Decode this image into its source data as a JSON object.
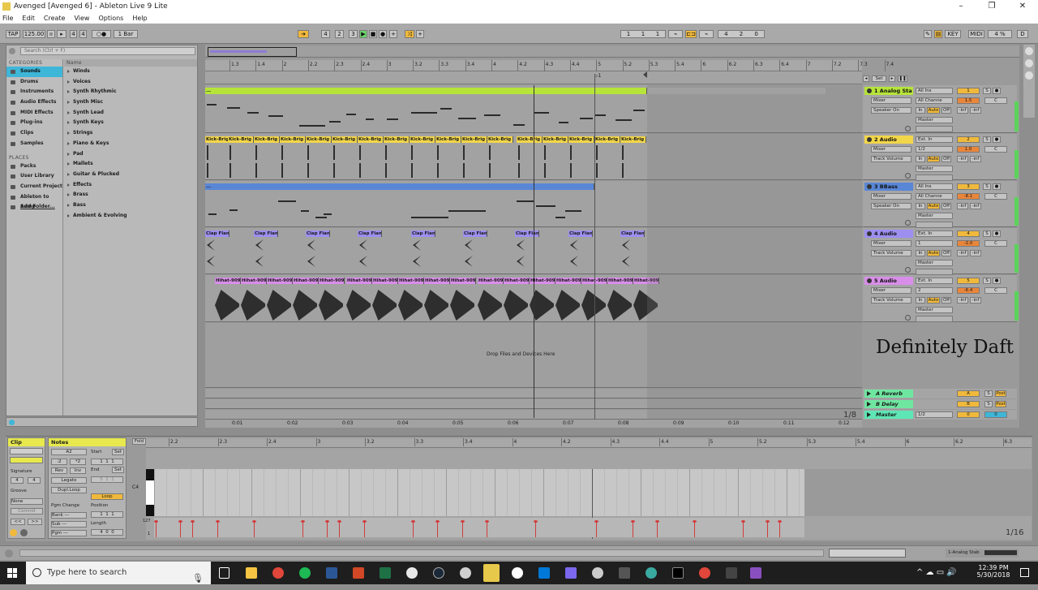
{
  "window": {
    "title": "Avenged  [Avenged 6] - Ableton Live 9 Lite",
    "controls": [
      "–",
      "❐",
      "✕"
    ]
  },
  "menu": [
    "File",
    "Edit",
    "Create",
    "View",
    "Options",
    "Help"
  ],
  "control_bar": {
    "tap": "TAP",
    "tempo": "125.00",
    "sig_num": "4",
    "sig_den": "4",
    "quant": "1 Bar",
    "pos": [
      "4",
      "2",
      "3"
    ],
    "loop_start": [
      "1",
      "1",
      "1"
    ],
    "loop_len": [
      "4",
      "2",
      "0"
    ],
    "key": "KEY",
    "midi": "MIDI",
    "cpu": "4 %",
    "h": "H",
    "d": "D"
  },
  "browser": {
    "search_placeholder": "Search (Ctrl + F)",
    "categories_header": "CATEGORIES",
    "name_header": "Name",
    "categories": [
      "Sounds",
      "Drums",
      "Instruments",
      "Audio Effects",
      "MIDI Effects",
      "Plug-ins",
      "Clips",
      "Samples"
    ],
    "places_header": "PLACES",
    "places": [
      "Packs",
      "User Library",
      "Current Project",
      "Ableton to Samp",
      "Add Folder..."
    ],
    "names": [
      "Winds",
      "Voices",
      "Synth Rhythmic",
      "Synth Misc",
      "Synth Lead",
      "Synth Keys",
      "Strings",
      "Piano & Keys",
      "Pad",
      "Mallets",
      "Guitar & Plucked",
      "Effects",
      "Brass",
      "Bass",
      "Ambient & Evolving"
    ]
  },
  "ruler": {
    "marks": [
      "1.3",
      "1.4",
      "2",
      "2.2",
      "2.3",
      "2.4",
      "3",
      "3.2",
      "3.3",
      "3.4",
      "4",
      "4.2",
      "4.3",
      "4.4",
      "5",
      "5.2",
      "5.3",
      "5.4",
      "6",
      "6.2",
      "6.3",
      "6.4",
      "7",
      "7.2",
      "7.3",
      "7.4"
    ],
    "time_marks": [
      "0:01",
      "0:02",
      "0:03",
      "0:04",
      "0:05",
      "0:06",
      "0:07",
      "0:08",
      "0:09",
      "0:10",
      "0:11",
      "0:12"
    ],
    "loop_label": "1",
    "set_label": "Set"
  },
  "tracks": [
    {
      "name": "1 Analog Sta",
      "clip_color": "#b7e43a",
      "input": "All Ins",
      "channel": "All Channe",
      "route": "Mixer",
      "out": "Speaker On",
      "master": "Master",
      "num": "1",
      "vol": "1.5",
      "pan": "C",
      "clip": "..."
    },
    {
      "name": "2 Audio",
      "clip_color": "#f2d64a",
      "input": "Ext. In",
      "channel": "1/2",
      "route": "Mixer",
      "out": "Track Volume",
      "master": "Master",
      "num": "2",
      "vol": "1.0",
      "pan": "C",
      "clip": "Kick-Brig"
    },
    {
      "name": "3 BBass",
      "clip_color": "#5a86d6",
      "input": "All Ins",
      "channel": "All Channe",
      "route": "Mixer",
      "out": "Speaker On",
      "master": "Master",
      "num": "3",
      "vol": "-8.1",
      "pan": "C",
      "clip": "..."
    },
    {
      "name": "4 Audio",
      "clip_color": "#9c8ff0",
      "input": "Ext. In",
      "channel": "1",
      "route": "Mixer",
      "out": "Track Volume",
      "master": "Master",
      "num": "4",
      "vol": "-2.0",
      "pan": "C",
      "clip": "Clap Flan"
    },
    {
      "name": "5 Audio",
      "clip_color": "#d88ee8",
      "input": "Ext. In",
      "channel": "2",
      "route": "Mixer",
      "out": "Track Volume",
      "master": "Master",
      "num": "5",
      "vol": "-6.4",
      "pan": "C",
      "clip": "Hihat-909"
    }
  ],
  "returns": [
    {
      "name": "A Reverb",
      "letter": "A"
    },
    {
      "name": "B Delay",
      "letter": "B"
    },
    {
      "name": "Master",
      "letter": "0"
    }
  ],
  "drop_text": "Drop Files and Devices Here",
  "watermark": "Definitely Daft",
  "master_sel": "1/2",
  "post": "Post",
  "inf": "-inf",
  "grid_frac": "1/8",
  "clip_view": {
    "clip": "Clip",
    "notes": "Notes",
    "fold": "Fold",
    "sig_label": "Signature",
    "sig": [
      "4",
      "4"
    ],
    "groove_label": "Groove",
    "groove": "None",
    "commit": "Commit",
    "range": "A2",
    "btns": [
      "Rev",
      "Inv",
      "Legato",
      "Dupl.Loop",
      "Loop"
    ],
    "start": "Start",
    "end": "End",
    "position": "Position",
    "length": "Length",
    "set": "Set",
    "pgm": "Pgm Change",
    "bank": "Bank ---",
    "sub": "Sub ---",
    "pgm2": "Pgm ---",
    "x2": [
      ":2",
      "*2"
    ],
    "c4": "C4",
    "v127": "127",
    "v1": "1",
    "grid": "1/16",
    "ruler": [
      "2.2",
      "2.3",
      "2.4",
      "3",
      "3.2",
      "3.3",
      "3.4",
      "4",
      "4.2",
      "4.3",
      "4.4",
      "5",
      "5.2",
      "5.3",
      "5.4",
      "6",
      "6.2",
      "6.3"
    ]
  },
  "status": {
    "track": "1-Analog Stab"
  },
  "taskbar": {
    "search": "Type here to search",
    "time": "12:39 PM",
    "date": "5/30/2018"
  }
}
